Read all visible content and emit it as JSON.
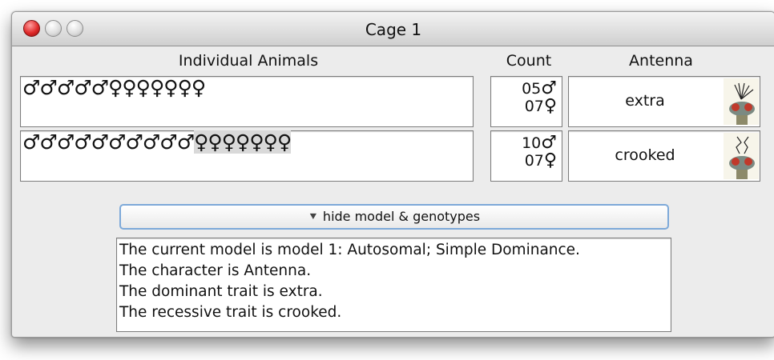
{
  "window": {
    "title": "Cage 1"
  },
  "headers": {
    "animals": "Individual Animals",
    "count": "Count",
    "trait": "Antenna"
  },
  "rows": [
    {
      "males_symbols": "♂♂♂♂♂",
      "females_symbols": "♀♀♀♀♀♀♀",
      "male_count": "05",
      "female_count": "07",
      "trait": "extra",
      "icon": "fly-extra-antenna-icon"
    },
    {
      "males_symbols": "♂♂♂♂♂♂♂♂♂♂",
      "females_symbols": "♀♀♀♀♀♀♀",
      "male_count": "10",
      "female_count": "07",
      "trait": "crooked",
      "icon": "fly-crooked-antenna-icon"
    }
  ],
  "symbols": {
    "male": "♂",
    "female": "♀"
  },
  "toggle": {
    "label": "hide model & genotypes",
    "icon": "double-chevron-down-icon"
  },
  "model_text": [
    "The current model is model 1: Autosomal; Simple Dominance.",
    "The character is Antenna.",
    "The dominant trait is extra.",
    "The recessive trait is crooked."
  ]
}
